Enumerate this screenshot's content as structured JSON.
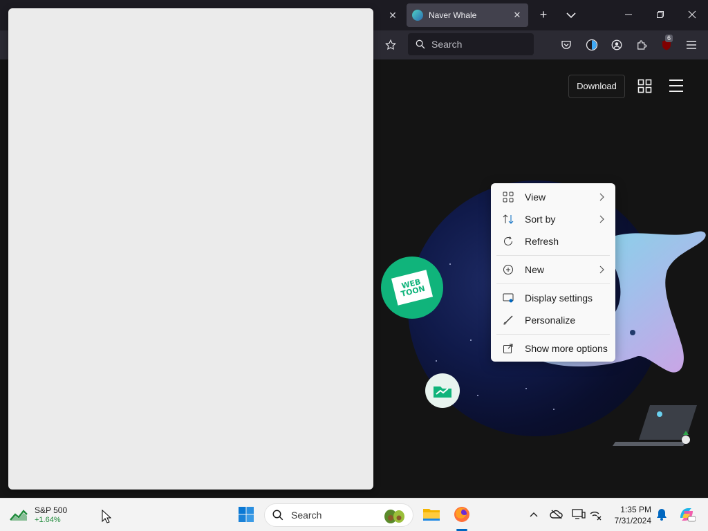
{
  "browser": {
    "active_tab_title": "Naver Whale",
    "new_tab_label": "+",
    "url_placeholder": "Search",
    "extension_badge": "6"
  },
  "page": {
    "download_label": "Download",
    "webtoon_logo_text": "WEB TOON"
  },
  "context_menu": {
    "items": [
      {
        "label": "View",
        "icon": "grid-icon",
        "submenu": true
      },
      {
        "label": "Sort by",
        "icon": "sort-icon",
        "submenu": true
      },
      {
        "label": "Refresh",
        "icon": "refresh-icon",
        "submenu": false
      },
      {
        "label": "New",
        "icon": "plus-circle-icon",
        "submenu": true
      },
      {
        "label": "Display settings",
        "icon": "display-settings-icon",
        "submenu": false
      },
      {
        "label": "Personalize",
        "icon": "brush-icon",
        "submenu": false
      },
      {
        "label": "Show more options",
        "icon": "external-icon",
        "submenu": false
      }
    ]
  },
  "taskbar": {
    "widget_title": "S&P 500",
    "widget_value": "+1.64%",
    "search_placeholder": "Search",
    "time": "1:35 PM",
    "date": "7/31/2024"
  },
  "colors": {
    "accent": "#0067c0",
    "webtoon_green": "#10b47b",
    "gain_green": "#1e8a3a"
  }
}
